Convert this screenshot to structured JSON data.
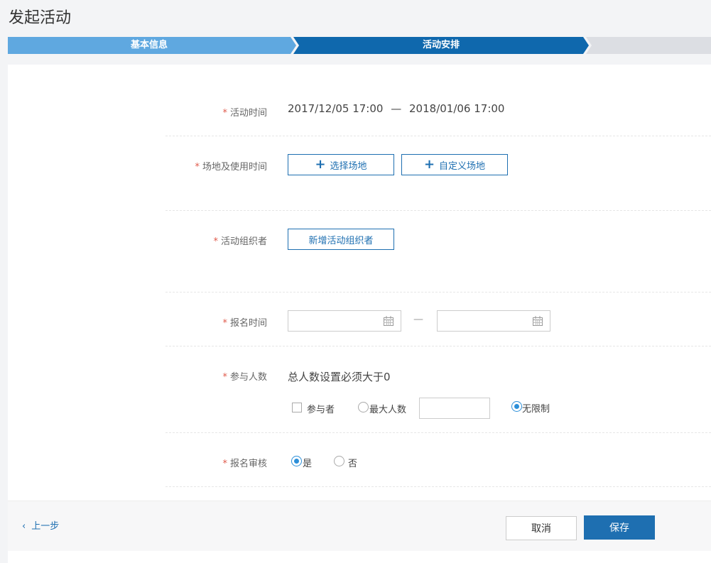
{
  "page": {
    "title": "发起活动"
  },
  "steps": [
    {
      "label": "基本信息",
      "state": "done",
      "color": "#5fa8e0"
    },
    {
      "label": "活动安排",
      "state": "active",
      "color": "#0f68ad"
    },
    {
      "label": "",
      "state": "pending",
      "color": "#dcdee3"
    }
  ],
  "required_mark": "*",
  "form": {
    "activity_time": {
      "label": "活动时间",
      "start": "2017/12/05 17:00",
      "separator": "—",
      "end": "2018/01/06 17:00"
    },
    "venue": {
      "label": "场地及使用时间",
      "select_button": "选择场地",
      "custom_button": "自定义场地"
    },
    "organizer": {
      "label": "活动组织者",
      "add_button": "新增活动组织者"
    },
    "registration_time": {
      "label": "报名时间",
      "start_value": "",
      "end_value": "",
      "separator": "—"
    },
    "participants": {
      "label": "参与人数",
      "hint": "总人数设置必须大于0",
      "participant_option": "参与者",
      "participant_checked": false,
      "max_option": "最大人数",
      "max_checked": false,
      "max_value": "",
      "unlimited_option": "无限制",
      "unlimited_checked": true
    },
    "review": {
      "label": "报名审核",
      "yes_option": "是",
      "yes_checked": true,
      "no_option": "否",
      "no_checked": false
    }
  },
  "footer": {
    "prev_label": "上一步",
    "cancel_label": "取消",
    "save_label": "保存"
  },
  "colors": {
    "primary": "#1e6fb1",
    "required": "#e05a4b",
    "radio_checked": "#2c8fd9"
  }
}
